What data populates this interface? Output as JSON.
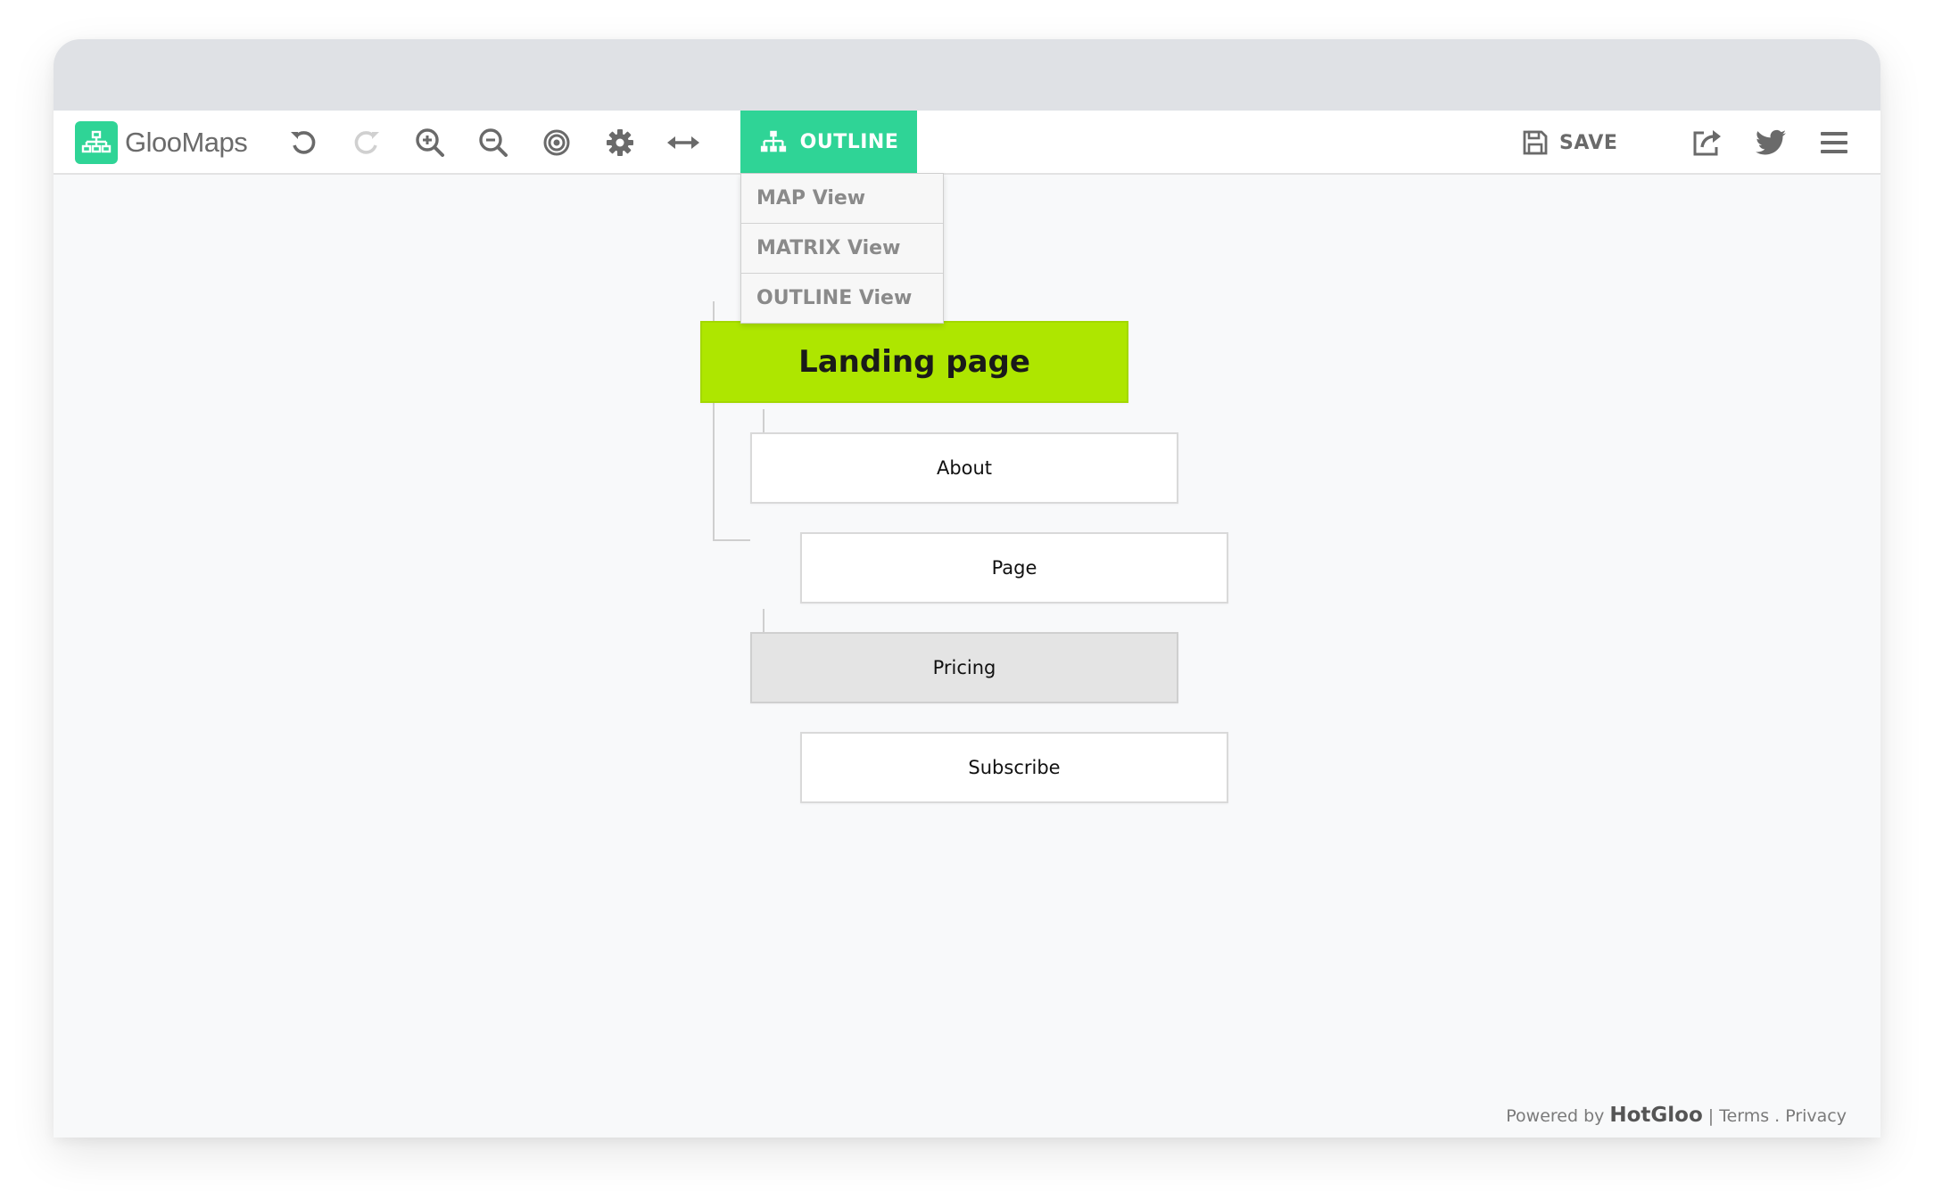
{
  "app": {
    "name": "GlooMaps"
  },
  "toolbar": {
    "tools": [
      {
        "icon": "undo-icon"
      },
      {
        "icon": "redo-icon"
      },
      {
        "icon": "zoom-in-icon"
      },
      {
        "icon": "zoom-out-icon"
      },
      {
        "icon": "target-icon"
      },
      {
        "icon": "gear-icon"
      },
      {
        "icon": "horizontal-arrows-icon"
      }
    ],
    "outline_label": "OUTLINE",
    "save_label": "SAVE",
    "right_icons": [
      "share-icon",
      "twitter-icon",
      "hamburger-menu-icon"
    ]
  },
  "view_menu": {
    "items": [
      {
        "label": "MAP View"
      },
      {
        "label": "MATRIX View"
      },
      {
        "label": "OUTLINE View"
      }
    ]
  },
  "sitemap": {
    "root": "Landing page",
    "nodes": [
      {
        "label": "About",
        "level": 1
      },
      {
        "label": "Page",
        "level": 2
      },
      {
        "label": "Pricing",
        "level": 1,
        "selected": true
      },
      {
        "label": "Subscribe",
        "level": 2
      }
    ]
  },
  "footer": {
    "powered_by": "Powered by",
    "brand": "HotGloo",
    "separator": "|",
    "terms": "Terms",
    "dot": ".",
    "privacy": "Privacy"
  },
  "colors": {
    "accent": "#2fd496",
    "root_node": "#aee600",
    "selected_node": "#e4e4e4"
  }
}
